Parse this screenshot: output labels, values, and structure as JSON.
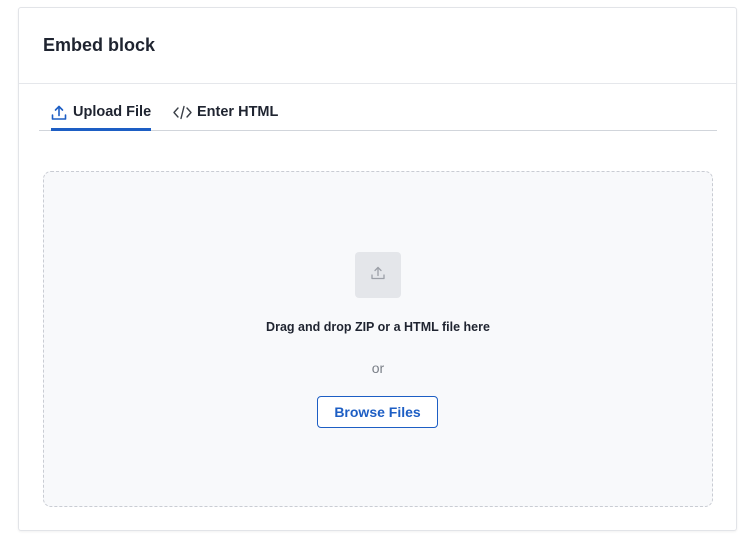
{
  "card": {
    "title": "Embed block"
  },
  "tabs": [
    {
      "label": "Upload File",
      "icon": "upload-icon",
      "active": true
    },
    {
      "label": "Enter HTML",
      "icon": "code-icon",
      "active": false
    }
  ],
  "dropzone": {
    "icon": "upload-icon",
    "instruction": "Drag and drop ZIP or a HTML file here",
    "separator": "or",
    "browse_label": "Browse Files"
  },
  "colors": {
    "accent": "#1d5ec4",
    "dropzone_bg": "#f8f9fb",
    "dropzone_border": "#c9ccd3",
    "icon_tile_bg": "#e4e6ea"
  }
}
